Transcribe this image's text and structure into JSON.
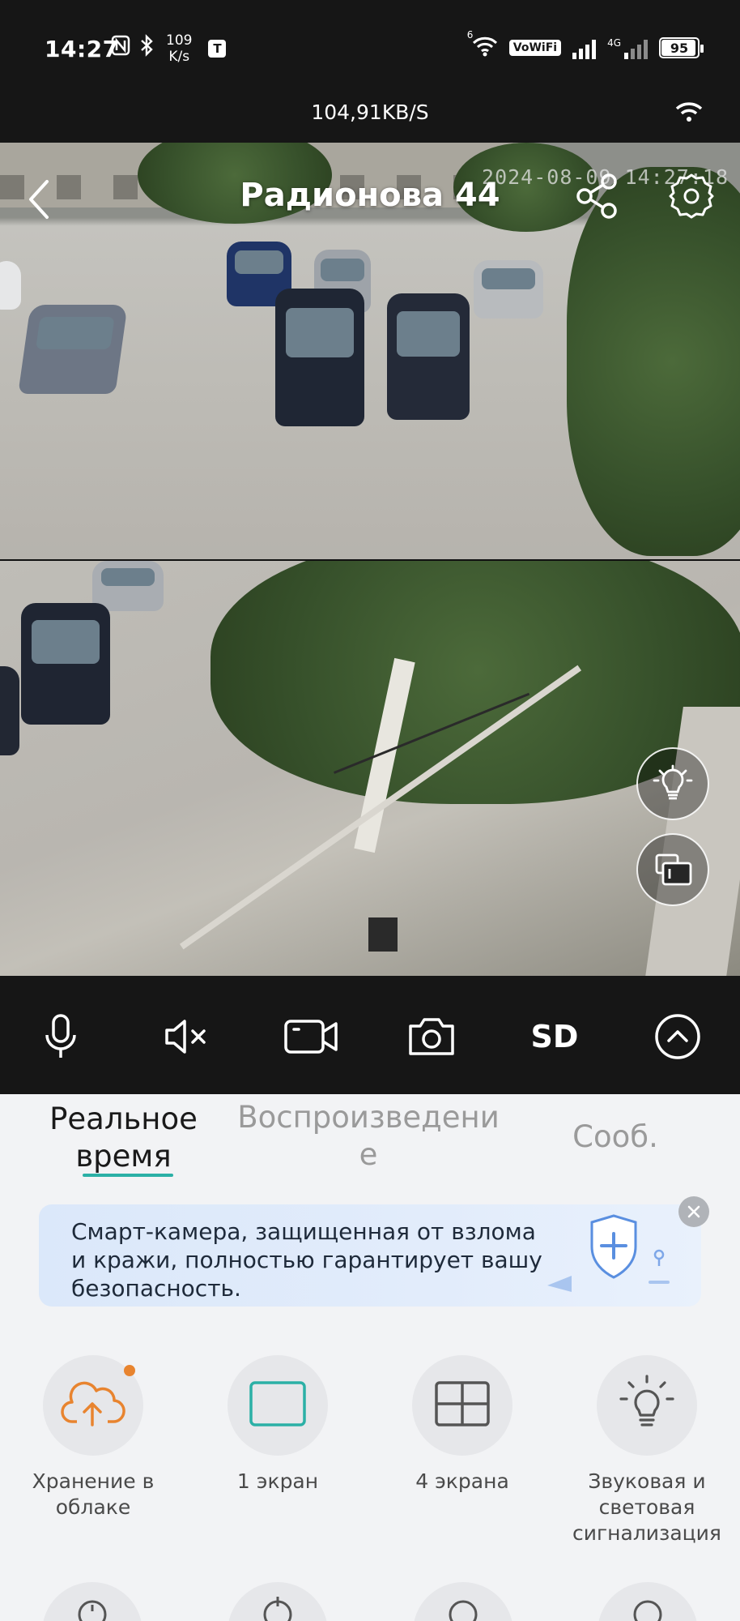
{
  "status_bar": {
    "time": "14:27",
    "net_speed_value": "109",
    "net_speed_unit": "K/s",
    "notif_icon_label": "T",
    "vowifi": "VoWiFi",
    "wifi_sub": "6",
    "lte_label": "4G",
    "battery": "95",
    "battery_level_percent": 95
  },
  "video_header": {
    "speed": "104,91KB/S",
    "camera_name": "Радионова 44",
    "timestamp": "2024-08-09 14:27:18"
  },
  "controls": {
    "sd_label": "SD"
  },
  "tabs": {
    "realtime": "Реальное время",
    "playback": "Воспроизведение",
    "messages": "Сооб."
  },
  "banner": {
    "text": "Смарт-камера, защищенная от взлома и кражи, полностью гарантирует вашу безопасность."
  },
  "features": [
    {
      "label": "Хранение в облаке",
      "icon": "cloud-upload-icon"
    },
    {
      "label": "1 экран",
      "icon": "single-screen-icon"
    },
    {
      "label": "4 экрана",
      "icon": "quad-screen-icon"
    },
    {
      "label": "Звуковая и световая сигнализация",
      "icon": "alarm-light-icon"
    }
  ],
  "colors": {
    "accent": "#2bb0a6",
    "cloud_orange": "#e8842f",
    "dark_bar": "#161616"
  }
}
